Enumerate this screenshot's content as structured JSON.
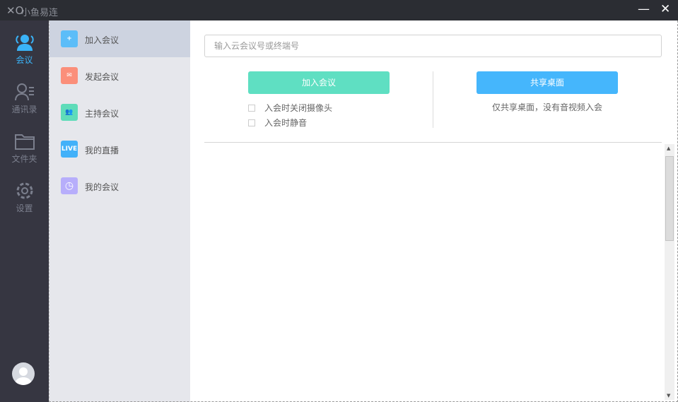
{
  "app": {
    "title": "小鱼易连",
    "minimize": "—",
    "close": "✕"
  },
  "nav": [
    {
      "label": "会议",
      "icon": "meeting-icon"
    },
    {
      "label": "通讯录",
      "icon": "contacts-icon"
    },
    {
      "label": "文件夹",
      "icon": "folder-icon"
    },
    {
      "label": "设置",
      "icon": "gear-icon"
    }
  ],
  "submenu": [
    {
      "label": "加入会议",
      "color": "#5cbdf8",
      "glyph": "+"
    },
    {
      "label": "发起会议",
      "color": "#fb8f7a",
      "glyph": "✉"
    },
    {
      "label": "主持会议",
      "color": "#5fdcb9",
      "glyph": "👥"
    },
    {
      "label": "我的直播",
      "color": "#42b1f9",
      "glyph": "LIVE"
    },
    {
      "label": "我的会议",
      "color": "#b7aefb",
      "glyph": "◷"
    }
  ],
  "main": {
    "search_placeholder": "输入云会议号或终端号",
    "join_label": "加入会议",
    "share_label": "共享桌面",
    "share_hint": "仅共享桌面，没有音视频入会",
    "opt_camera": "入会时关闭摄像头",
    "opt_mute": "入会时静音",
    "join_color": "#5fdfc2",
    "share_color": "#45b6fc"
  }
}
